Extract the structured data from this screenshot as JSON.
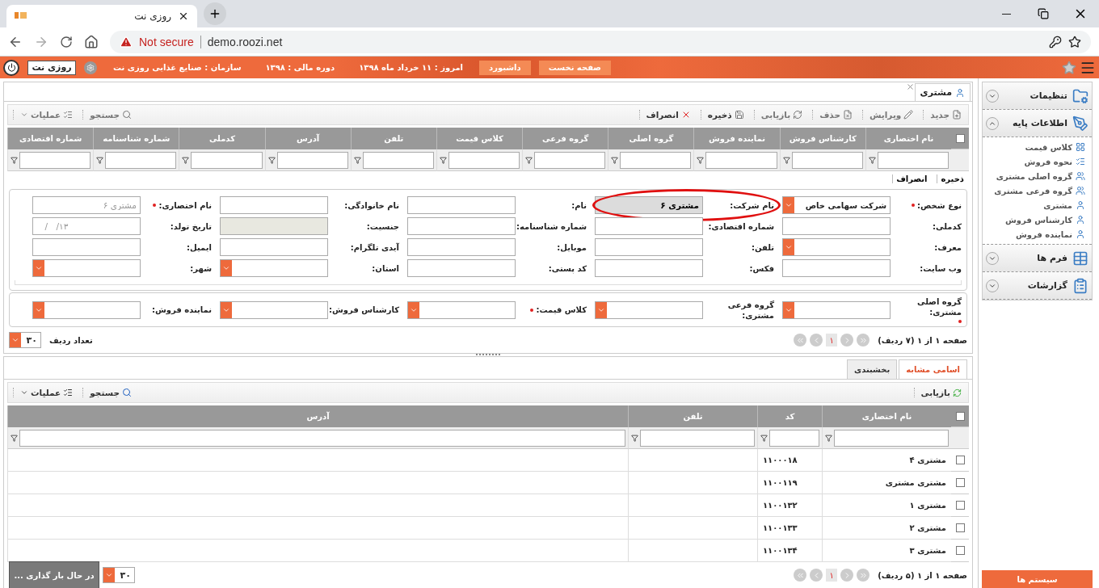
{
  "browser": {
    "tab_title": "روزی نت",
    "security": "Not secure",
    "url": "demo.roozi.net"
  },
  "app_bar": {
    "buttons": [
      "صفحه نخست",
      "داشبورد"
    ],
    "info": [
      "امروز : ۱۱ خرداد ماه ۱۳۹۸",
      "دوره مالی : ۱۳۹۸",
      "سازمان : صنایع غذایی روزی نت"
    ],
    "user": "روزی نت"
  },
  "page_tab": {
    "label": "مشتری"
  },
  "toolbar": {
    "actions": [
      {
        "label": "جدید",
        "kind": "new"
      },
      {
        "label": "ویرایش",
        "kind": "edit"
      },
      {
        "label": "حذف",
        "kind": "delete"
      },
      {
        "label": "بازیابی",
        "kind": "refresh"
      },
      {
        "label": "ذخیره",
        "kind": "save"
      },
      {
        "label": "انصراف",
        "kind": "cancel"
      }
    ],
    "search": "جستجو",
    "operations": "عملیات"
  },
  "table": {
    "all_checked": false,
    "columns": [
      "نام اختصاری",
      "کارشناس فروش",
      "نماینده فروش",
      "گروه اصلی",
      "گروه فرعی",
      "کلاس قیمت",
      "تلفن",
      "آدرس",
      "کدملی",
      "شماره شناسنامه",
      "شماره اقتصادی"
    ]
  },
  "form_toolbar": [
    "ذخیره",
    "انصراف"
  ],
  "form": {
    "rows": [
      [
        {
          "label": "نوع شخص:",
          "kind": "select",
          "required": true,
          "value": "شرکت سهامی خاص"
        },
        {
          "label": "نام شرکت:",
          "kind": "text",
          "value": "مشتری ۶",
          "annotated": true
        },
        {
          "label": "نام:",
          "kind": "text"
        },
        {
          "label": "نام خانوادگی:",
          "kind": "text"
        },
        {
          "label": "نام اختصاری:",
          "kind": "text",
          "required": true,
          "placeholder": "مشتری ۶"
        }
      ],
      [
        {
          "label": "کدملی:",
          "kind": "text"
        },
        {
          "label": "شماره اقتصادی:",
          "kind": "text"
        },
        {
          "label": "شماره شناسنامه:",
          "kind": "text"
        },
        {
          "label": "جنسیت:",
          "kind": "text",
          "disabled": true
        },
        {
          "label": "تاریخ تولد:",
          "kind": "text",
          "placeholder": "__/__/۱۳"
        }
      ],
      [
        {
          "label": "معرف:",
          "kind": "select"
        },
        {
          "label": "تلفن:",
          "kind": "text"
        },
        {
          "label": "موبایل:",
          "kind": "text"
        },
        {
          "label": "آیدی تلگرام:",
          "kind": "text"
        },
        {
          "label": "ایمیل:",
          "kind": "text"
        }
      ],
      [
        {
          "label": "وب سایت:",
          "kind": "text"
        },
        {
          "label": "فکس:",
          "kind": "text"
        },
        {
          "label": "کد پستی:",
          "kind": "text"
        },
        {
          "label": "استان:",
          "kind": "select"
        },
        {
          "label": "شهر:",
          "kind": "select"
        }
      ]
    ],
    "groups": [
      {
        "label": "گروه اصلی مشتری:",
        "required": true
      },
      {
        "label": "گروه فرعی مشتری:",
        "required": false
      },
      {
        "label": "کلاس قیمت:",
        "required": true
      },
      {
        "label": "کارشناس فروش:",
        "required": false
      },
      {
        "label": "نماینده فروش:",
        "required": false
      }
    ]
  },
  "pager": {
    "summary": "صفحه ۱ از ۱ (۷ ردیف)",
    "page": "۱",
    "page_size": "۳۰",
    "page_size_label": "تعداد ردیف"
  },
  "bottom": {
    "tabs": [
      {
        "label": "اسامی مشابه",
        "selected": true
      },
      {
        "label": "بخشبندی",
        "selected": false
      }
    ],
    "toolbar": {
      "refresh": "بازیابی",
      "search": "جستجو",
      "operations": "عملیات"
    },
    "table": {
      "all_checked": false,
      "columns": [
        "نام اختصاری",
        "کد",
        "تلفن",
        "آدرس"
      ],
      "rows": [
        {
          "name": "مشتری ۴",
          "code": "۱۱۰۰۰۱۸",
          "checked": false
        },
        {
          "name": "مشتری مشتری",
          "code": "۱۱۰۰۱۱۹",
          "checked": false
        },
        {
          "name": "مشتری ۱",
          "code": "۱۱۰۰۱۳۲",
          "checked": false
        },
        {
          "name": "مشتری ۲",
          "code": "۱۱۰۰۱۳۳",
          "checked": false
        },
        {
          "name": "مشتری ۳",
          "code": "۱۱۰۰۱۳۴",
          "checked": false
        }
      ]
    },
    "pager": {
      "summary": "صفحه ۱ از ۱ (۵ ردیف)",
      "page": "۱",
      "page_size": "۳۰"
    },
    "loading": "در حال بار گذاری ..."
  },
  "sidebar": {
    "sections": [
      {
        "label": "تنظیمات",
        "kind": "settings",
        "expanded": false
      },
      {
        "label": "اطلاعات پایه",
        "kind": "base",
        "expanded": true,
        "children": [
          {
            "label": "کلاس قیمت",
            "kind": "grid"
          },
          {
            "label": "نحوه فروش",
            "kind": "table"
          },
          {
            "label": "گروه اصلی مشتری",
            "kind": "group"
          },
          {
            "label": "گروه فرعی مشتری",
            "kind": "group"
          },
          {
            "label": "مشتری",
            "kind": "user"
          },
          {
            "label": "کارشناس فروش",
            "kind": "user"
          },
          {
            "label": "نماینده فروش",
            "kind": "user"
          }
        ]
      },
      {
        "label": "فرم ها",
        "kind": "forms",
        "expanded": false
      },
      {
        "label": "گزارشات",
        "kind": "reports",
        "expanded": false
      }
    ],
    "system_button": "سیستم ها"
  }
}
